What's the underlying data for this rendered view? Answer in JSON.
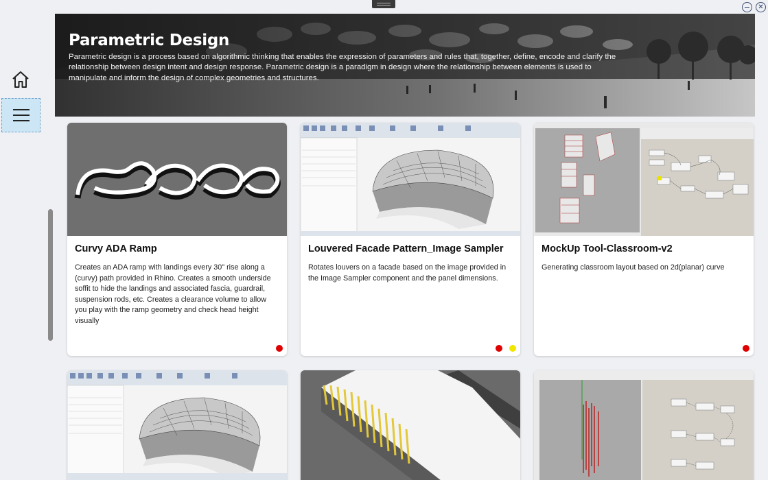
{
  "window": {
    "minimize_icon": "minimize-icon",
    "close_icon": "close-icon",
    "close_glyph": "✕"
  },
  "sidebar": {
    "home_icon": "home-icon",
    "menu_icon": "hamburger-menu-icon"
  },
  "hero": {
    "title": "Parametric Design",
    "description": "Parametric design is a process based on algorithmic thinking that enables the expression of parameters and rules that, together, define, encode and clarify the relationship between design intent and design response. Parametric design is a paradigm in design where the relationship between elements is used to manipulate and inform the design of complex geometries and structures."
  },
  "cards": [
    {
      "title": "Curvy ADA Ramp",
      "description": " Creates an ADA ramp with landings every 30\" rise along a (curvy) path provided in Rhino. Creates a smooth underside soffit to hide the landings and associated fascia, guardrail, suspension rods, etc. Creates a clearance volume to allow you play with the ramp geometry and check head height visually",
      "status_colors": [
        "#e00000"
      ]
    },
    {
      "title": "Louvered Facade Pattern_Image Sampler",
      "description": " Rotates louvers on a facade based on the image provided in the Image Sampler component and the panel dimensions.",
      "status_colors": [
        "#e00000",
        "#f2e600"
      ]
    },
    {
      "title": "MockUp Tool-Classroom-v2",
      "description": " Generating classroom layout based on 2d(planar) curve",
      "status_colors": [
        "#e00000"
      ]
    },
    {
      "title": "",
      "description": ""
    },
    {
      "title": "",
      "description": ""
    },
    {
      "title": "",
      "description": ""
    }
  ]
}
